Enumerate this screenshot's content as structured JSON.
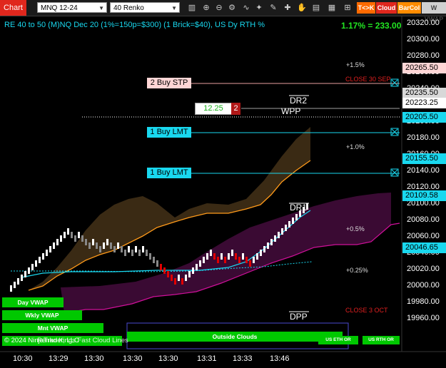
{
  "window": {
    "title": "Chart"
  },
  "toolbar": {
    "instrument": "MNQ 12-24",
    "bar_type": "40 Renko",
    "buttons": [
      "T<>K",
      "Cloud",
      "BarCol",
      "W VWAP"
    ]
  },
  "chart": {
    "header": "RE 40 to 50 (M)NQ Dec 20 (1%=150p=$300) (1 Brick=$40), US Dy RTH %",
    "pl_display": "1.17% = 233.00",
    "copyright": "© 2024 NinjaTrader, LLC",
    "watermark": "Renko Kings Fast Cloud Lines",
    "price_axis": [
      "20320.00",
      "20300.00",
      "20280.00",
      "20260.00",
      "20240.00",
      "20220.00",
      "20200.00",
      "20180.00",
      "20160.00",
      "20140.00",
      "20120.00",
      "20100.00",
      "20080.00",
      "20060.00",
      "20040.00",
      "20020.00",
      "20000.00",
      "19980.00",
      "19960.00"
    ],
    "time_axis": [
      "10:30",
      "13:29",
      "13:30",
      "13:30",
      "13:30",
      "13:31",
      "13:33",
      "13:46"
    ],
    "price_markers": [
      {
        "text": "20265.50",
        "bg": "#ffd6d6",
        "fg": "#000"
      },
      {
        "text": "20235.50",
        "bg": "#d8d8d8",
        "fg": "#000"
      },
      {
        "text": "20223.25",
        "bg": "#ffffff",
        "fg": "#000"
      },
      {
        "text": "20205.50",
        "bg": "#19d8ef",
        "fg": "#000"
      },
      {
        "text": "20155.50",
        "bg": "#19d8ef",
        "fg": "#000"
      },
      {
        "text": "20109.58",
        "bg": "#19d8ef",
        "fg": "#000"
      },
      {
        "text": "20046.65",
        "bg": "#19d8ef",
        "fg": "#000"
      }
    ],
    "orders": {
      "stop": "2 Buy STP",
      "limit1": "1 Buy LMT",
      "limit2": "1 Buy LMT",
      "position_pnl": "12.25",
      "position_qty": "2"
    },
    "levels": {
      "plus_1_5": "+1.5%",
      "close_30_sep": "CLOSE 30 SEP",
      "dr2": "DR2",
      "wpp": "WPP",
      "plus_1_0": "+1.0%",
      "dr1": "DR1",
      "plus_0_5": "+0.5%",
      "plus_0_25": "+0.25%",
      "close_3_oct": "CLOSE 3 OCT",
      "dpp": "DPP"
    },
    "vwap_labels": {
      "day": "Day VWAP",
      "wkly": "Wkly VWAP",
      "mnt": "Mnt VWAP",
      "outside": "Outside Clouds",
      "us_eth": "US ETH OR",
      "us_rth": "US RTH OR"
    },
    "colors": {
      "up_brick": "#ffffff",
      "down_brick": "#888888",
      "red_brick": "#e00000",
      "fast_cloud": "#3a2a14",
      "orange_line": "#ff9a1a",
      "magenta_cloud": "#3a0a33",
      "cyan_line": "#19d8ef",
      "vwap_green": "#00c800"
    }
  }
}
